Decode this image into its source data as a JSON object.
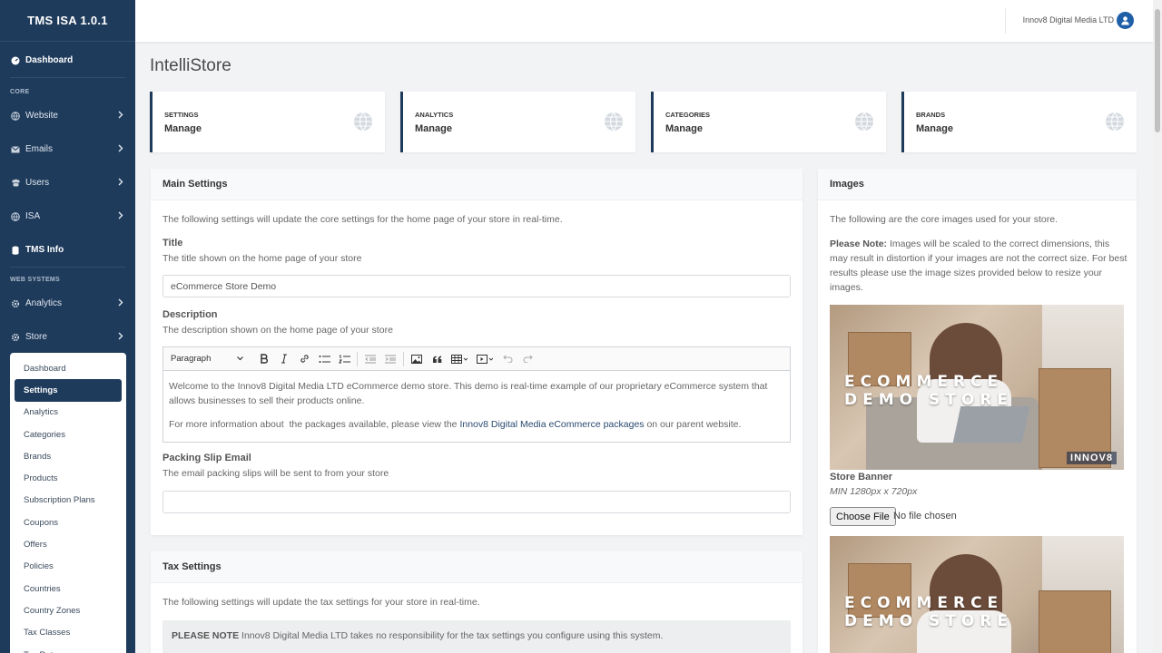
{
  "app": {
    "title": "TMS ISA 1.0.1"
  },
  "sidebar": {
    "dashboard": "Dashboard",
    "core_heading": "CORE",
    "core_items": [
      {
        "label": "Website",
        "icon": "globe-icon"
      },
      {
        "label": "Emails",
        "icon": "envelope-icon"
      },
      {
        "label": "Users",
        "icon": "users-icon"
      },
      {
        "label": "ISA",
        "icon": "globe-icon"
      }
    ],
    "tms_info": "TMS Info",
    "web_heading": "WEB SYSTEMS",
    "web_items": [
      {
        "label": "Analytics",
        "icon": "gear-icon"
      },
      {
        "label": "Store",
        "icon": "gear-icon"
      }
    ],
    "store_submenu": [
      "Dashboard",
      "Settings",
      "Analytics",
      "Categories",
      "Brands",
      "Products",
      "Subscription Plans",
      "Coupons",
      "Offers",
      "Policies",
      "Countries",
      "Country Zones",
      "Tax Classes",
      "Tax Rates"
    ],
    "active_submenu": "Settings"
  },
  "topbar": {
    "user": "Innov8 Digital Media LTD"
  },
  "page": {
    "title": "IntelliStore"
  },
  "cards": [
    {
      "label": "SETTINGS",
      "value": "Manage"
    },
    {
      "label": "ANALYTICS",
      "value": "Manage"
    },
    {
      "label": "CATEGORIES",
      "value": "Manage"
    },
    {
      "label": "BRANDS",
      "value": "Manage"
    }
  ],
  "main_settings": {
    "heading": "Main Settings",
    "intro": "The following settings will update the core settings for the home page of your store in real-time.",
    "title_label": "Title",
    "title_help": "The title shown on the home page of your store",
    "title_value": "eCommerce Store Demo",
    "description_label": "Description",
    "description_help": "The description shown on the home page of your store",
    "editor": {
      "block_format": "Paragraph",
      "para1": "Welcome to the Innov8 Digital Media LTD eCommerce demo store. This demo is real-time example of our proprietary eCommerce system that allows businesses to sell their products online.",
      "para2_before": "For more information about  the packages available, please view the ",
      "para2_link": "Innov8 Digital Media eCommerce packages",
      "para2_after": " on our parent website."
    },
    "packing_label": "Packing Slip Email",
    "packing_help": "The email packing slips will be sent to from your store",
    "packing_value": ""
  },
  "tax_settings": {
    "heading": "Tax Settings",
    "intro": "The following settings will update the tax settings for your store in real-time.",
    "note_bold": "PLEASE NOTE",
    "note_text": " Innov8 Digital Media LTD takes no responsibility for the tax settings you configure using this system."
  },
  "images": {
    "heading": "Images",
    "intro": "The following are the core images used for your store.",
    "note_bold": "Please Note:",
    "note_text": " Images will be scaled to the correct dimensions, this may result in distortion if your images are not the correct size. For best results please use the image sizes provided below to resize your images.",
    "banner_text_1": "ECOMMERCE",
    "banner_text_2": "DEMO STORE",
    "banner_logo": "INNOV8",
    "store_banner_label": "Store Banner",
    "store_banner_size": "MIN 1280px x 720px",
    "choose_file": "Choose File",
    "no_file": "No file chosen"
  }
}
